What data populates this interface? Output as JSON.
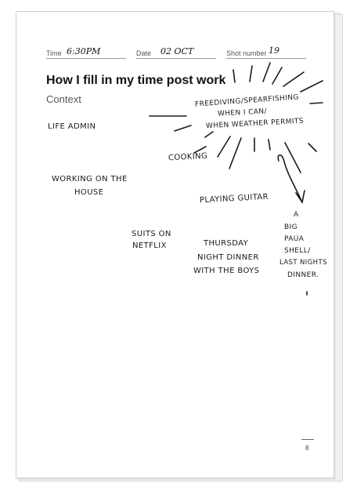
{
  "header": {
    "time_label": "Time",
    "time_value": "6:30PM",
    "date_label": "Date",
    "date_value": "02 OCT",
    "shot_label": "Shot number",
    "shot_value": "19"
  },
  "title": "How I fill in my time post work",
  "subtitle": "Context",
  "notes": {
    "life_admin": "LIFE ADMIN",
    "freediving_1": "FREEDIVING/SPEARFISHING",
    "freediving_2": "WHEN I CAN/",
    "freediving_3": "WHEN WEATHER PERMITS",
    "cooking": "COOKING",
    "house_1": "WORKING ON THE",
    "house_2": "HOUSE",
    "guitar": "PLAYING GUITAR",
    "suits_1": "SUITS ON",
    "suits_2": "NETFLIX",
    "thursday_1": "THURSDAY",
    "thursday_2": "NIGHT DINNER",
    "thursday_3": "WITH THE BOYS",
    "paua_1": "A",
    "paua_2": "BIG",
    "paua_3": "PAUA",
    "paua_4": "SHELL/",
    "paua_5": "LAST NIGHTS",
    "paua_6": "DINNER."
  },
  "page_number": "8"
}
